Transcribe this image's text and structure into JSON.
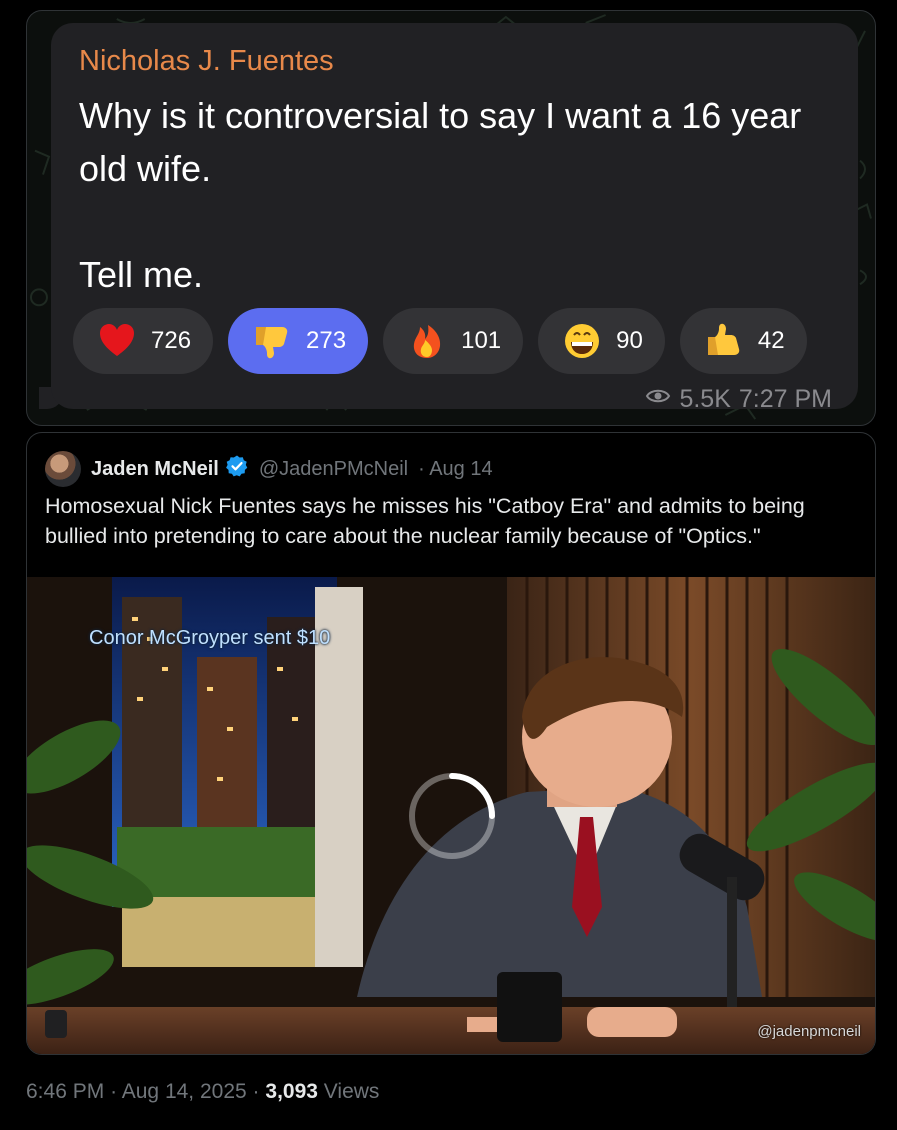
{
  "telegram_message": {
    "sender": "Nicholas J. Fuentes",
    "text": "Why is it controversial to say I want a 16 year old wife.\n\nTell me.",
    "reactions": [
      {
        "emoji": "red-heart-icon",
        "count": "726",
        "active": false
      },
      {
        "emoji": "thumbs-down-icon",
        "count": "273",
        "active": true
      },
      {
        "emoji": "fire-icon",
        "count": "101",
        "active": false
      },
      {
        "emoji": "grinning-face-icon",
        "count": "90",
        "active": false
      },
      {
        "emoji": "thumbs-up-icon",
        "count": "42",
        "active": false
      }
    ],
    "views": "5.5K",
    "time": "7:27 PM"
  },
  "quoted_tweet": {
    "author_name": "Jaden McNeil",
    "author_handle": "@JadenPMcNeil",
    "date": "· Aug 14",
    "text": "Homosexual Nick Fuentes says he misses his \"Catboy Era\" and admits to being bullied into pretending to care about the nuclear family because of \"Optics.\"",
    "media": {
      "overlay_text": "Conor McGroyper sent $10",
      "watermark": "@jadenpmcneil",
      "loading": true
    }
  },
  "tweet_footer": {
    "time": "6:46 PM",
    "separator": "·",
    "date": "Aug 14, 2025",
    "views_count": "3,093",
    "views_label": "Views"
  },
  "colors": {
    "sender_name": "#e8894a",
    "active_reaction": "#5c6df0",
    "bubble": "#212124",
    "verified_badge": "#1d9bf0"
  }
}
